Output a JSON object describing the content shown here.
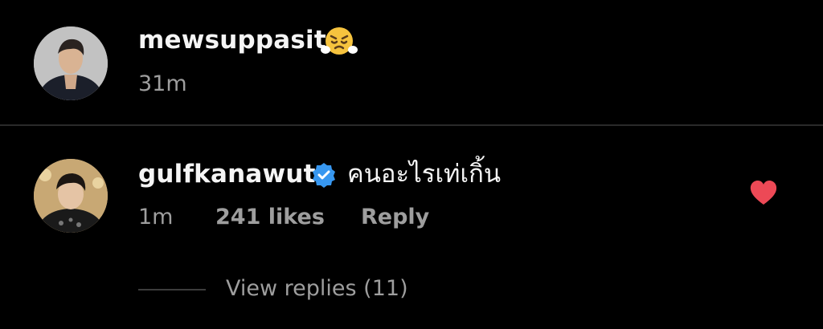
{
  "comments": [
    {
      "username": "mewsuppasit",
      "emoji": "huffing-face-emoji",
      "time": "31m"
    },
    {
      "username": "gulfkanawut",
      "verified": true,
      "text": "คนอะไรเท่เกิ้น",
      "time": "1m",
      "likes": "241 likes",
      "reply_label": "Reply",
      "liked": true,
      "view_replies": "View replies (11)"
    }
  ],
  "colors": {
    "background": "#000000",
    "primary_text": "#f5f5f5",
    "secondary_text": "#9e9e9e",
    "verified_blue": "#3797f0",
    "heart_red": "#ed4956"
  },
  "icons": {
    "verified": "verified-badge-icon",
    "heart": "heart-icon"
  }
}
